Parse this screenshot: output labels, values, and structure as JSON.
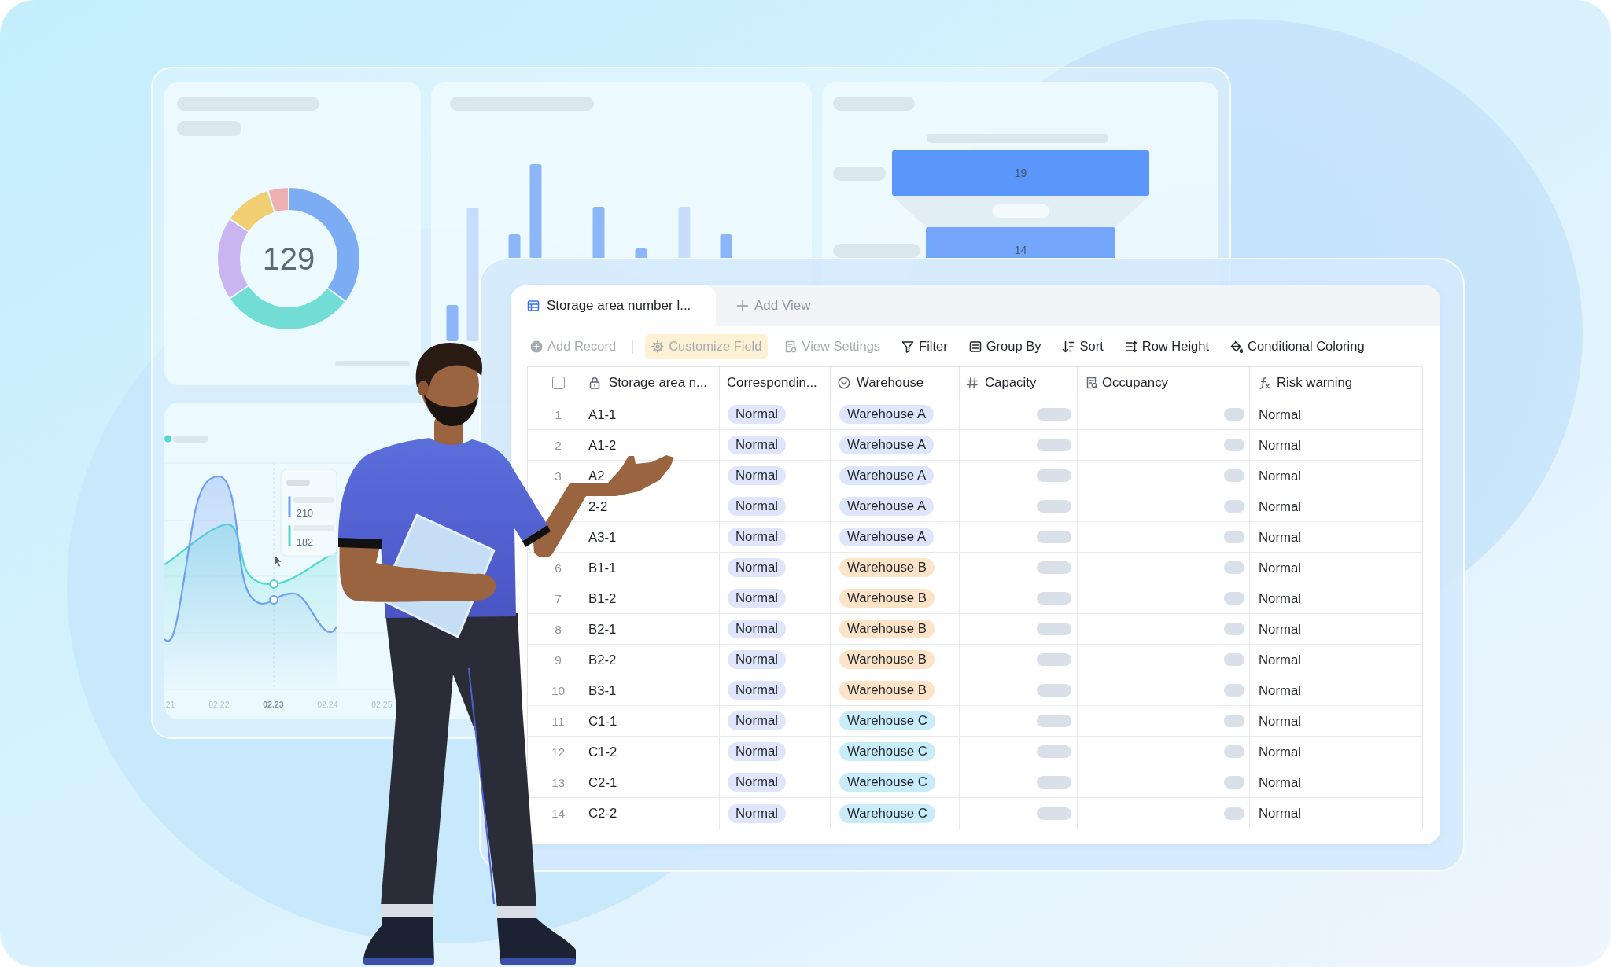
{
  "dashboard": {
    "donut_card": {
      "total": "129"
    },
    "funnel_card": {
      "stages": [
        {
          "value": "19"
        },
        {
          "value": "14"
        }
      ]
    },
    "line_card": {
      "tooltip": {
        "items": [
          {
            "value": "210",
            "color": "#6f9ff2"
          },
          {
            "value": "182",
            "color": "#4fd8cf"
          }
        ]
      },
      "x_labels": [
        {
          "label": ".21",
          "selected": false
        },
        {
          "label": "02.22",
          "selected": false
        },
        {
          "label": "02.23",
          "selected": true
        },
        {
          "label": "02.24",
          "selected": false
        },
        {
          "label": "02.25",
          "selected": false
        }
      ]
    }
  },
  "table_view": {
    "tabs": [
      {
        "label": "Storage area number l...",
        "selected": true
      }
    ],
    "add_view": {
      "label": "Add View"
    },
    "toolbar": [
      {
        "kind": "add",
        "label": "Add Record",
        "disabled": true,
        "highlighted": false
      },
      {
        "kind": "divider"
      },
      {
        "kind": "fields",
        "label": "Customize Field",
        "disabled": true,
        "highlighted": true
      },
      {
        "kind": "settings",
        "label": "View Settings",
        "disabled": true,
        "highlighted": false
      },
      {
        "kind": "filter",
        "label": "Filter",
        "disabled": false,
        "highlighted": false
      },
      {
        "kind": "group",
        "label": "Group By",
        "disabled": false,
        "highlighted": false
      },
      {
        "kind": "sort",
        "label": "Sort",
        "disabled": false,
        "highlighted": false
      },
      {
        "kind": "row_height",
        "label": "Row Height",
        "disabled": false,
        "highlighted": false
      },
      {
        "kind": "coloring",
        "label": "Conditional Coloring",
        "disabled": false,
        "highlighted": false
      }
    ],
    "select_all": {
      "checked": false
    },
    "columns": [
      {
        "kind": "primary",
        "label": "Storage area n..."
      },
      {
        "kind": "text",
        "label": "Correspondin..."
      },
      {
        "kind": "select",
        "label": "Warehouse"
      },
      {
        "kind": "number",
        "label": "Capacity"
      },
      {
        "kind": "lookup",
        "label": "Occupancy"
      },
      {
        "kind": "formula",
        "label": "Risk warning"
      }
    ],
    "rows": [
      {
        "number": "1",
        "name": "A1-1",
        "status": "Normal",
        "warehouse": {
          "label": "Warehouse A",
          "color": "#dee6fc"
        },
        "risk": "Normal"
      },
      {
        "number": "2",
        "name": "A1-2",
        "status": "Normal",
        "warehouse": {
          "label": "Warehouse A",
          "color": "#dee6fc"
        },
        "risk": "Normal"
      },
      {
        "number": "3",
        "name": "A2",
        "status": "Normal",
        "warehouse": {
          "label": "Warehouse A",
          "color": "#dee6fc"
        },
        "risk": "Normal"
      },
      {
        "name": "2-2",
        "status": "Normal",
        "warehouse": {
          "label": "Warehouse A",
          "color": "#dee6fc"
        },
        "risk": "Normal"
      },
      {
        "name": "A3-1",
        "status": "Normal",
        "warehouse": {
          "label": "Warehouse A",
          "color": "#dee6fc"
        },
        "risk": "Normal"
      },
      {
        "number": "6",
        "name": "B1-1",
        "status": "Normal",
        "warehouse": {
          "label": "Warehouse B",
          "color": "#fde3c8"
        },
        "risk": "Normal"
      },
      {
        "number": "7",
        "name": "B1-2",
        "status": "Normal",
        "warehouse": {
          "label": "Warehouse B",
          "color": "#fde3c8"
        },
        "risk": "Normal"
      },
      {
        "number": "8",
        "name": "B2-1",
        "status": "Normal",
        "warehouse": {
          "label": "Warehouse B",
          "color": "#fde3c8"
        },
        "risk": "Normal"
      },
      {
        "number": "9",
        "name": "B2-2",
        "status": "Normal",
        "warehouse": {
          "label": "Warehouse B",
          "color": "#fde3c8"
        },
        "risk": "Normal"
      },
      {
        "number": "10",
        "name": "B3-1",
        "status": "Normal",
        "warehouse": {
          "label": "Warehouse B",
          "color": "#fde3c8"
        },
        "risk": "Normal"
      },
      {
        "number": "11",
        "name": "C1-1",
        "status": "Normal",
        "warehouse": {
          "label": "Warehouse C",
          "color": "#c8ecf9"
        },
        "risk": "Normal"
      },
      {
        "number": "12",
        "name": "C1-2",
        "status": "Normal",
        "warehouse": {
          "label": "Warehouse C",
          "color": "#c8ecf9"
        },
        "risk": "Normal"
      },
      {
        "number": "13",
        "name": "C2-1",
        "status": "Normal",
        "warehouse": {
          "label": "Warehouse C",
          "color": "#c8ecf9"
        },
        "risk": "Normal"
      },
      {
        "number": "14",
        "name": "C2-2",
        "status": "Normal",
        "warehouse": {
          "label": "Warehouse C",
          "color": "#c8ecf9"
        },
        "risk": "Normal"
      }
    ]
  }
}
